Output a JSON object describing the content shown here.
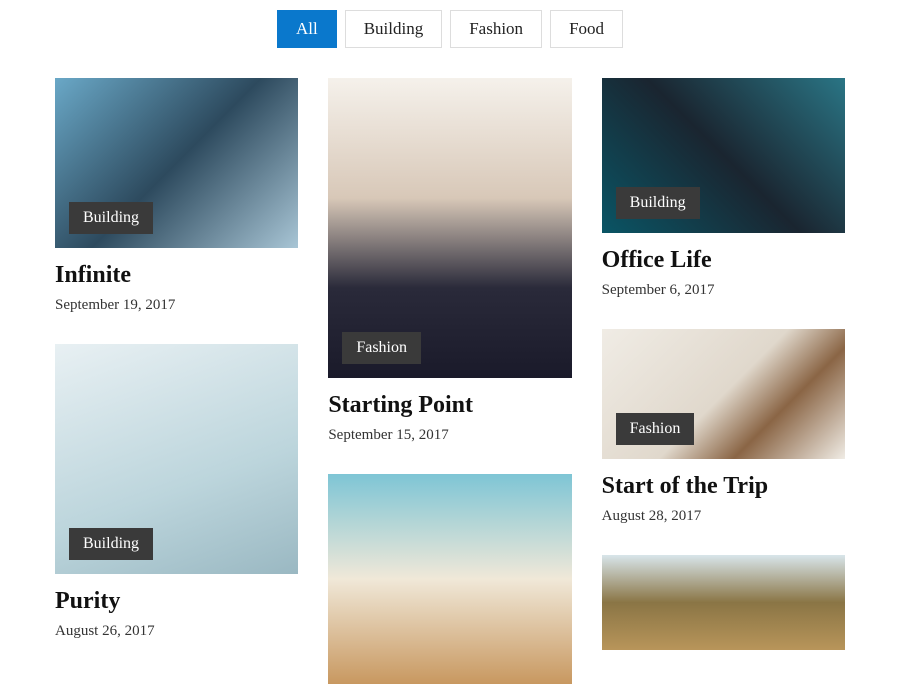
{
  "filters": {
    "all": "All",
    "building": "Building",
    "fashion": "Fashion",
    "food": "Food"
  },
  "cards": {
    "infinite": {
      "category": "Building",
      "title": "Infinite",
      "date": "September 19, 2017"
    },
    "purity": {
      "category": "Building",
      "title": "Purity",
      "date": "August 26, 2017"
    },
    "starting": {
      "category": "Fashion",
      "title": "Starting Point",
      "date": "September 15, 2017"
    },
    "office": {
      "category": "Building",
      "title": "Office Life",
      "date": "September 6, 2017"
    },
    "trip": {
      "category": "Fashion",
      "title": "Start of the Trip",
      "date": "August 28, 2017"
    }
  }
}
